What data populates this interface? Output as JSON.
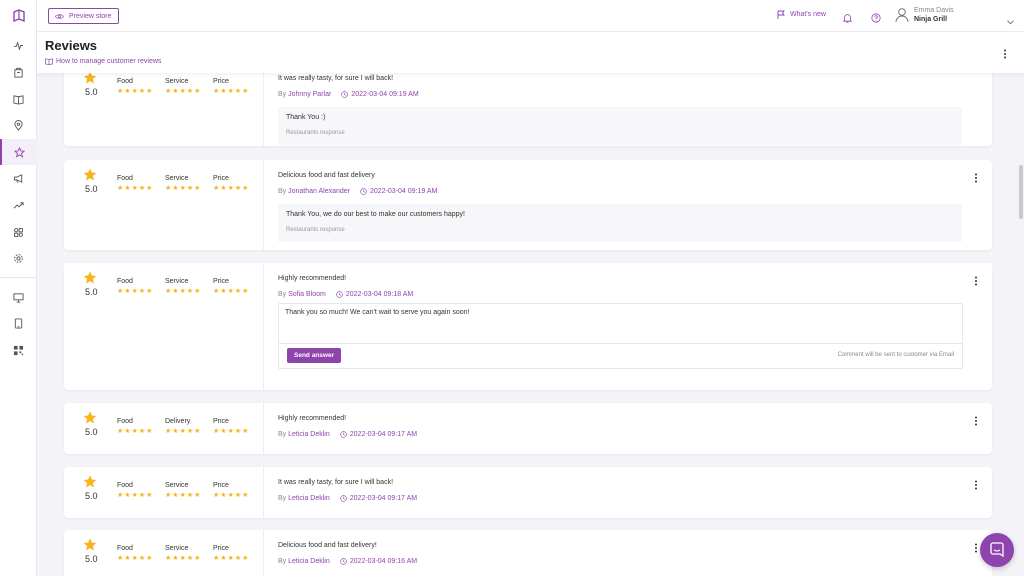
{
  "topbar": {
    "preview_label": "Preview store",
    "whats_new_label": "What's new",
    "user_name": "Emma Davis",
    "store_name": "Ninja Grill"
  },
  "header": {
    "title": "Reviews",
    "help_link": "How to manage customer reviews"
  },
  "sidebar": {
    "icons": [
      "logo-icon",
      "activity-icon",
      "orders-icon",
      "menu-book-icon",
      "location-icon",
      "star-icon",
      "megaphone-icon",
      "trending-icon",
      "apps-icon",
      "settings-icon",
      "monitor-icon",
      "tablet-icon",
      "qr-code-icon"
    ],
    "active": "star-icon"
  },
  "accent_color": "#8e44ad",
  "star_color": "#f6b51e",
  "reviews": [
    {
      "score": "5.0",
      "categories": [
        "Food",
        "Service",
        "Price"
      ],
      "text": "It was really tasty, for sure I will back!",
      "author_prefix": "By",
      "author": "Johnny Parlar",
      "date": "2022-03-04 09:19 AM",
      "response": "Thank You :)",
      "response_label": "Restaurants response"
    },
    {
      "score": "5.0",
      "categories": [
        "Food",
        "Service",
        "Price"
      ],
      "text": "Delicious food and fast delivery",
      "author_prefix": "By",
      "author": "Jonathan Alexander",
      "date": "2022-03-04 09:19 AM",
      "response": "Thank You, we do our best to make our customers happy!",
      "response_label": "Restaurants response"
    },
    {
      "score": "5.0",
      "categories": [
        "Food",
        "Service",
        "Price"
      ],
      "text": "Highly recommended!",
      "author_prefix": "By",
      "author": "Sofia Bloom",
      "date": "2022-03-04 09:18 AM",
      "reply_value": "Thank you so much! We can't wait to serve you again soon!",
      "send_label": "Send answer",
      "reply_hint": "Comment will be sent to customer via Email"
    },
    {
      "score": "5.0",
      "categories": [
        "Food",
        "Delivery",
        "Price"
      ],
      "text": "Highly recommended!",
      "author_prefix": "By",
      "author": "Leticia Deklin",
      "date": "2022-03-04 09:17 AM"
    },
    {
      "score": "5.0",
      "categories": [
        "Food",
        "Service",
        "Price"
      ],
      "text": "It was really tasty, for sure I will back!",
      "author_prefix": "By",
      "author": "Leticia Deklin",
      "date": "2022-03-04 09:17 AM"
    },
    {
      "score": "5.0",
      "categories": [
        "Food",
        "Service",
        "Price"
      ],
      "text": "Delicious food and fast delivery!",
      "author_prefix": "By",
      "author": "Leticia Deklin",
      "date": "2022-03-04 09:16 AM"
    }
  ]
}
